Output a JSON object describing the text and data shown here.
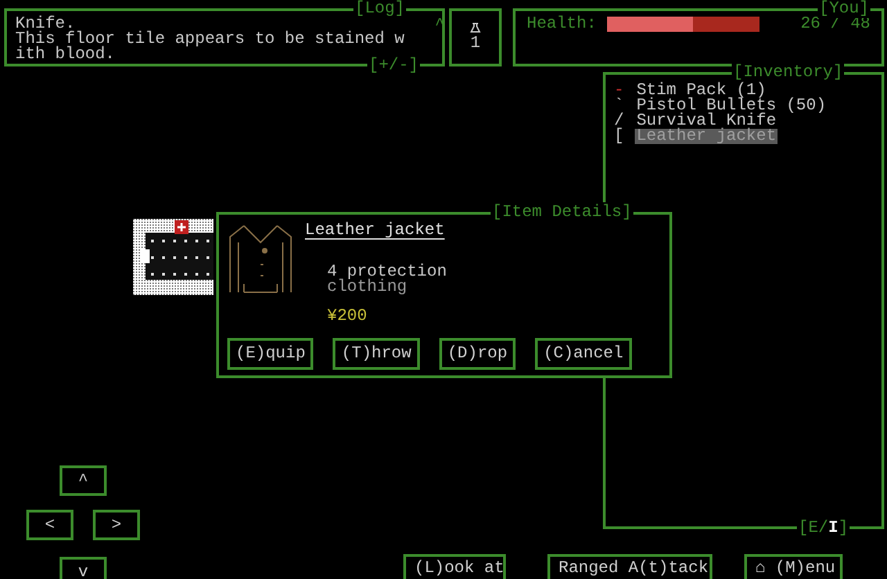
{
  "log": {
    "title": "[Log]",
    "lines": [
      "Knife.",
      "This floor tile appears to be stained w",
      "ith blood."
    ],
    "scroll_marker": "^",
    "toggle": "[+/-]"
  },
  "counter": {
    "value": "1"
  },
  "you": {
    "title": "[You]",
    "health_label": "Health:",
    "health": {
      "level": 0.56
    },
    "health_reading": "26 / 48"
  },
  "inventory": {
    "title": "[Inventory]",
    "toggle": "[E/**I**]",
    "items": [
      {
        "glyph": "-",
        "label": "Stim Pack (1)",
        "color": "#d03030",
        "selected": false
      },
      {
        "glyph": "`",
        "label": "Pistol Bullets (50)",
        "color": "#c8c8c8",
        "selected": false
      },
      {
        "glyph": "/",
        "label": "Survival Knife",
        "color": "#c8c8c8",
        "selected": false
      },
      {
        "glyph": "[",
        "label": "Leather jacket",
        "color": "#c8c8c8",
        "selected": true
      }
    ]
  },
  "item_details": {
    "title": "[Item Details]",
    "name": "Leather jacket",
    "stat": "4 protection",
    "category": "clothing",
    "price": "¥200",
    "buttons": [
      "(E)quip",
      "(T)hrow",
      "(D)rop",
      "(C)ancel"
    ]
  },
  "dpad": [
    "^",
    "<",
    ">",
    "v"
  ],
  "actions": [
    "(L)ook at",
    "Ranged A(t)tack",
    "⌂ (M)enu"
  ]
}
